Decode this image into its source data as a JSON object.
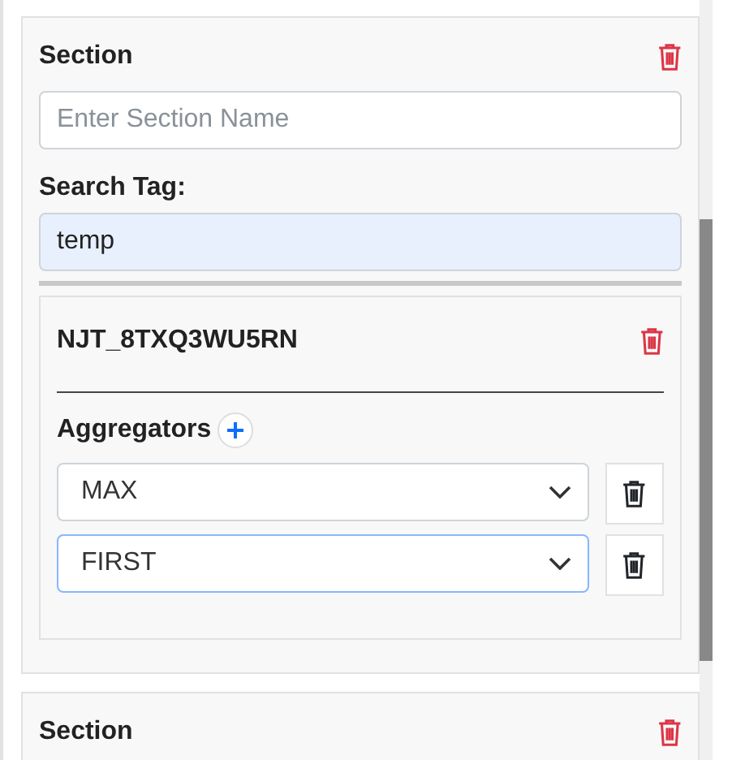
{
  "sections": [
    {
      "title": "Section",
      "name_field": {
        "placeholder": "Enter Section Name"
      },
      "search_label": "Search Tag:",
      "search_field": {
        "value": "temp"
      },
      "tags": [
        {
          "name": "NJT_8TXQ3WU5RN",
          "aggregators_label": "Aggregators",
          "aggregators": [
            {
              "value": "MAX",
              "focused": false
            },
            {
              "value": "FIRST",
              "focused": true
            }
          ]
        }
      ]
    },
    {
      "title": "Section"
    }
  ]
}
